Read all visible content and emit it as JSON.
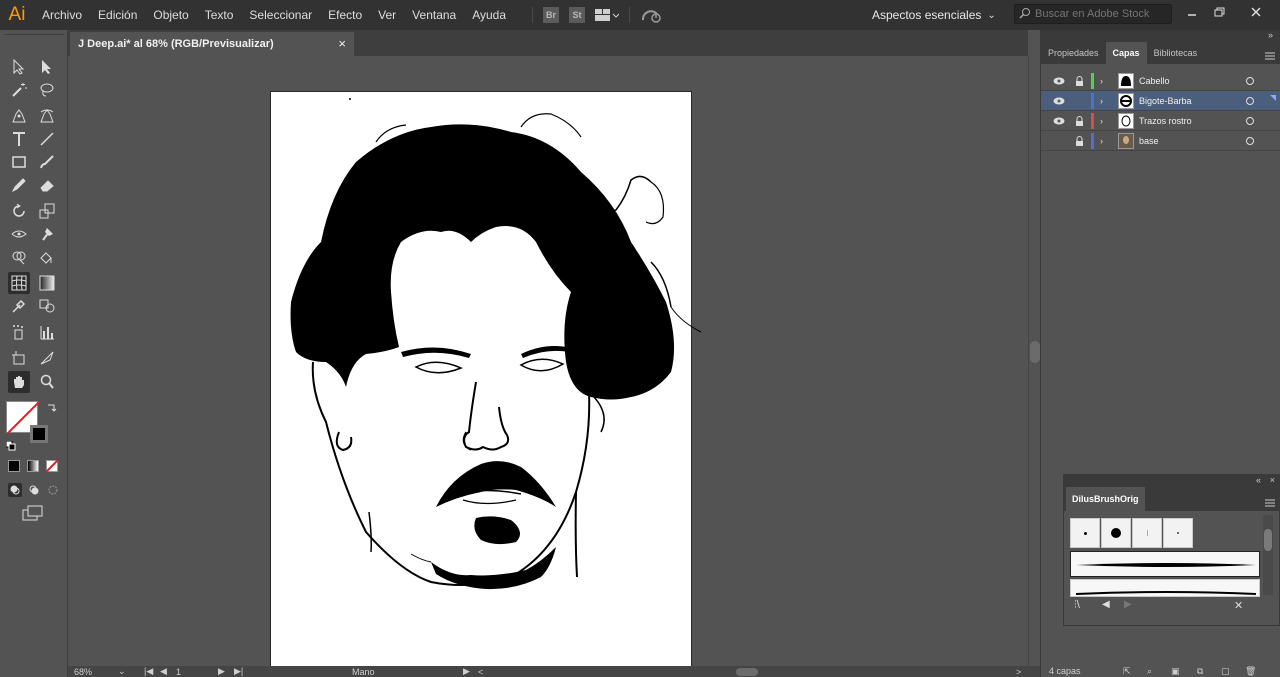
{
  "app": {
    "logo": "Ai",
    "menu": [
      "Archivo",
      "Edición",
      "Objeto",
      "Texto",
      "Seleccionar",
      "Efecto",
      "Ver",
      "Ventana",
      "Ayuda"
    ],
    "menu_icons": {
      "bridge": "Br",
      "stock": "St"
    },
    "workspace_label": "Aspectos esenciales",
    "search_placeholder": "Buscar en Adobe Stock"
  },
  "document": {
    "tab_title": "J Deep.ai* al 68% (RGB/Previsualizar)",
    "close_glyph": "×"
  },
  "status": {
    "zoom": "68%",
    "artboard_num": "1",
    "tool_name": "Mano"
  },
  "panels": {
    "tabs": [
      "Propiedades",
      "Capas",
      "Bibliotecas"
    ],
    "active_tab": "Capas",
    "layers": [
      {
        "name": "Cabello",
        "color": "#4fd44f",
        "visible": true,
        "locked": true,
        "selected": false
      },
      {
        "name": "Bigote-Barba",
        "color": "#4f6fd4",
        "visible": true,
        "locked": false,
        "selected": true
      },
      {
        "name": "Trazos rostro",
        "color": "#d44f4f",
        "visible": true,
        "locked": true,
        "selected": false
      },
      {
        "name": "base",
        "color": "#4f6fd4",
        "visible": false,
        "locked": true,
        "selected": false
      }
    ],
    "layer_count": "4 capas"
  },
  "brush_panel": {
    "tab": "DilusBrushOrig"
  },
  "colors": {
    "menubar_bg": "#323232",
    "ui_bg": "#535353",
    "accent_logo": "#ff9a00",
    "selection": "#4b5e7c"
  },
  "icons": [
    "arrange-documents-icon",
    "gpu-performance-icon",
    "search-icon",
    "eye-icon",
    "lock-icon",
    "chevron-right-icon",
    "target-circle-icon",
    "panel-menu-icon",
    "collapse-arrows-icon"
  ]
}
